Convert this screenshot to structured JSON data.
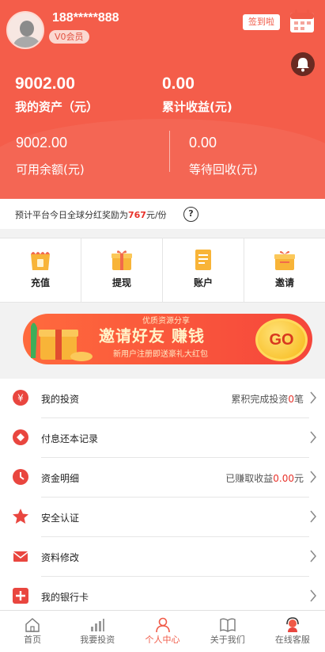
{
  "user": {
    "phone": "188*****888",
    "vip": "V0会员",
    "signin": "签到啦"
  },
  "assets": {
    "total_value": "9002.00",
    "total_label": "我的资产（元）",
    "income_value": "0.00",
    "income_label": "累计收益(元)",
    "available_value": "9002.00",
    "available_label": "可用余额(元)",
    "pending_value": "0.00",
    "pending_label": "等待回收(元)"
  },
  "notice": {
    "prefix": "预计平台今日全球分红奖励为",
    "amount": "767",
    "suffix": "元/份",
    "help": "?"
  },
  "actions": [
    {
      "label": "充值",
      "icon": "recharge-icon"
    },
    {
      "label": "提现",
      "icon": "withdraw-icon"
    },
    {
      "label": "账户",
      "icon": "account-icon"
    },
    {
      "label": "邀请",
      "icon": "invite-icon"
    }
  ],
  "banner": {
    "top": "优质资源分享",
    "main": "邀请好友 赚钱",
    "sub": "新用户注册即送豪礼大红包",
    "go": "GO"
  },
  "menu": [
    {
      "label": "我的投资",
      "value_prefix": "累积完成投资",
      "value_num": "0",
      "value_suffix": "笔",
      "icon": "yen-icon"
    },
    {
      "label": "付息还本记录",
      "icon": "record-icon"
    },
    {
      "label": "资金明细",
      "value_prefix": "已赚取收益",
      "value_num": "0.00",
      "value_suffix": "元",
      "icon": "clock-icon"
    },
    {
      "label": "安全认证",
      "icon": "star-icon"
    },
    {
      "label": "资料修改",
      "icon": "mail-icon"
    },
    {
      "label": "我的银行卡",
      "icon": "plus-icon"
    }
  ],
  "tabs": [
    {
      "label": "首页",
      "icon": "home-icon"
    },
    {
      "label": "我要投资",
      "icon": "invest-icon"
    },
    {
      "label": "个人中心",
      "icon": "user-icon",
      "active": true
    },
    {
      "label": "关于我们",
      "icon": "book-icon"
    },
    {
      "label": "在线客服",
      "icon": "service-icon"
    }
  ],
  "colors": {
    "accent": "#f45d4a",
    "highlight": "#e8322a"
  }
}
